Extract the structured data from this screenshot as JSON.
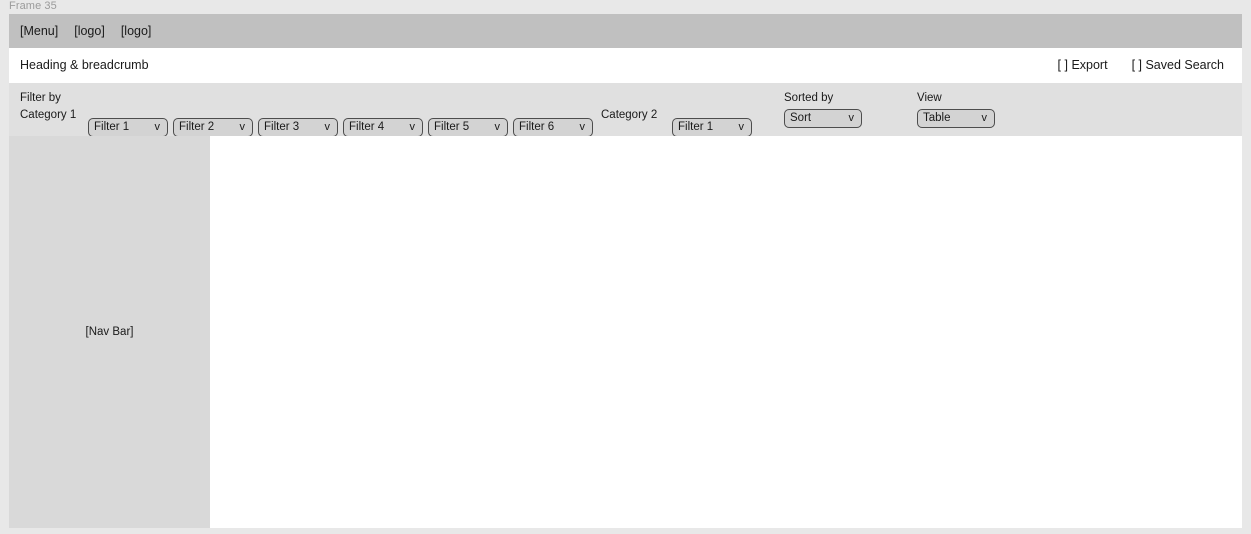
{
  "frame": {
    "label": "Frame 35"
  },
  "menubar": {
    "items": [
      {
        "label": "[Menu]"
      },
      {
        "label": "[logo]"
      },
      {
        "label": "[logo]"
      }
    ]
  },
  "heading": {
    "title": "Heading & breadcrumb",
    "actions": [
      {
        "label": "[ ] Export"
      },
      {
        "label": "[ ] Saved Search"
      }
    ]
  },
  "filterbar": {
    "filter_by_label": "Filter by",
    "category1_label": "Category 1",
    "category2_label": "Category 2",
    "sorted_by_label": "Sorted by",
    "view_label": "View",
    "chevron": "v",
    "category1_filters": [
      {
        "value": "Filter 1"
      },
      {
        "value": "Filter 2"
      },
      {
        "value": "Filter 3"
      },
      {
        "value": "Filter 4"
      },
      {
        "value": "Filter 5"
      },
      {
        "value": "Filter 6"
      }
    ],
    "category2_filters": [
      {
        "value": "Filter 1"
      }
    ],
    "sort": {
      "value": "Sort"
    },
    "view": {
      "value": "Table"
    }
  },
  "navbar": {
    "label": "[Nav Bar]"
  },
  "colors": {
    "canvas": "#e8e8e8",
    "menubar": "#c0c0c0",
    "filterbar": "#e0e0e0",
    "navbar": "#d9d9d9",
    "content": "#ffffff",
    "text": "#1a1a1a",
    "frame_label": "#9b9b9b",
    "control_fill": "#d3d3d3",
    "control_border": "#4d4d4d"
  }
}
